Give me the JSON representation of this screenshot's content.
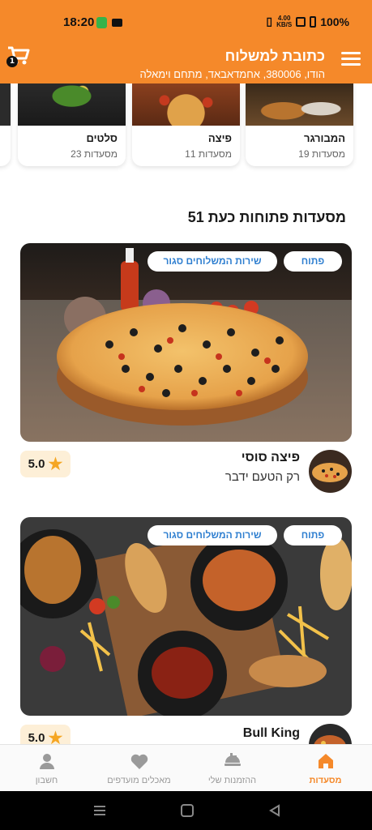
{
  "status_bar": {
    "time": "18:20",
    "net_speed": "4.00",
    "net_unit": "KB/S",
    "battery": "100%"
  },
  "header": {
    "title": "כתובת למשלוח",
    "address": "הודו, 380006, אחמדאבאד, מתחם וימאלה",
    "cart_count": "1"
  },
  "categories": [
    {
      "name": "המבורגר",
      "count": "19 מסעדות"
    },
    {
      "name": "פיצה",
      "count": "11 מסעדות"
    },
    {
      "name": "סלטים",
      "count": "23 מסעדות"
    }
  ],
  "section_title": "51 מסעדות פתוחות כעת",
  "restaurants": [
    {
      "status": "פתוח",
      "delivery": "שירות המשלוחים סגור",
      "name": "פיצה סוסי",
      "tagline": "רק הטעם ידבר",
      "rating": "5.0"
    },
    {
      "status": "פתוח",
      "delivery": "שירות המשלוחים סגור",
      "name": "Bull King",
      "tagline": "",
      "rating": "5.0"
    }
  ],
  "bottom_nav": [
    {
      "label": "מסעדות",
      "icon": "home-icon",
      "active": true
    },
    {
      "label": "ההזמנות שלי",
      "icon": "orders-icon",
      "active": false
    },
    {
      "label": "מאכלים מועדפים",
      "icon": "heart-icon",
      "active": false
    },
    {
      "label": "חשבון",
      "icon": "person-icon",
      "active": false
    }
  ],
  "colors": {
    "accent": "#f5892a",
    "link": "#2f7fd0",
    "rating_bg": "#fdefd7",
    "star": "#f5a623"
  }
}
